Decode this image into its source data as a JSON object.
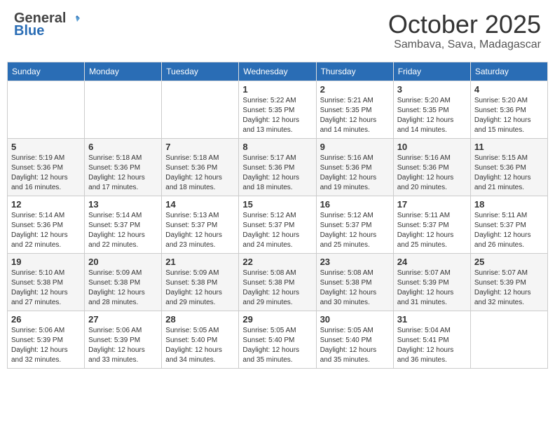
{
  "logo": {
    "general": "General",
    "blue": "Blue"
  },
  "header": {
    "month": "October 2025",
    "location": "Sambava, Sava, Madagascar"
  },
  "weekdays": [
    "Sunday",
    "Monday",
    "Tuesday",
    "Wednesday",
    "Thursday",
    "Friday",
    "Saturday"
  ],
  "weeks": [
    [
      {
        "day": "",
        "info": ""
      },
      {
        "day": "",
        "info": ""
      },
      {
        "day": "",
        "info": ""
      },
      {
        "day": "1",
        "info": "Sunrise: 5:22 AM\nSunset: 5:35 PM\nDaylight: 12 hours\nand 13 minutes."
      },
      {
        "day": "2",
        "info": "Sunrise: 5:21 AM\nSunset: 5:35 PM\nDaylight: 12 hours\nand 14 minutes."
      },
      {
        "day": "3",
        "info": "Sunrise: 5:20 AM\nSunset: 5:35 PM\nDaylight: 12 hours\nand 14 minutes."
      },
      {
        "day": "4",
        "info": "Sunrise: 5:20 AM\nSunset: 5:36 PM\nDaylight: 12 hours\nand 15 minutes."
      }
    ],
    [
      {
        "day": "5",
        "info": "Sunrise: 5:19 AM\nSunset: 5:36 PM\nDaylight: 12 hours\nand 16 minutes."
      },
      {
        "day": "6",
        "info": "Sunrise: 5:18 AM\nSunset: 5:36 PM\nDaylight: 12 hours\nand 17 minutes."
      },
      {
        "day": "7",
        "info": "Sunrise: 5:18 AM\nSunset: 5:36 PM\nDaylight: 12 hours\nand 18 minutes."
      },
      {
        "day": "8",
        "info": "Sunrise: 5:17 AM\nSunset: 5:36 PM\nDaylight: 12 hours\nand 18 minutes."
      },
      {
        "day": "9",
        "info": "Sunrise: 5:16 AM\nSunset: 5:36 PM\nDaylight: 12 hours\nand 19 minutes."
      },
      {
        "day": "10",
        "info": "Sunrise: 5:16 AM\nSunset: 5:36 PM\nDaylight: 12 hours\nand 20 minutes."
      },
      {
        "day": "11",
        "info": "Sunrise: 5:15 AM\nSunset: 5:36 PM\nDaylight: 12 hours\nand 21 minutes."
      }
    ],
    [
      {
        "day": "12",
        "info": "Sunrise: 5:14 AM\nSunset: 5:36 PM\nDaylight: 12 hours\nand 22 minutes."
      },
      {
        "day": "13",
        "info": "Sunrise: 5:14 AM\nSunset: 5:37 PM\nDaylight: 12 hours\nand 22 minutes."
      },
      {
        "day": "14",
        "info": "Sunrise: 5:13 AM\nSunset: 5:37 PM\nDaylight: 12 hours\nand 23 minutes."
      },
      {
        "day": "15",
        "info": "Sunrise: 5:12 AM\nSunset: 5:37 PM\nDaylight: 12 hours\nand 24 minutes."
      },
      {
        "day": "16",
        "info": "Sunrise: 5:12 AM\nSunset: 5:37 PM\nDaylight: 12 hours\nand 25 minutes."
      },
      {
        "day": "17",
        "info": "Sunrise: 5:11 AM\nSunset: 5:37 PM\nDaylight: 12 hours\nand 25 minutes."
      },
      {
        "day": "18",
        "info": "Sunrise: 5:11 AM\nSunset: 5:37 PM\nDaylight: 12 hours\nand 26 minutes."
      }
    ],
    [
      {
        "day": "19",
        "info": "Sunrise: 5:10 AM\nSunset: 5:38 PM\nDaylight: 12 hours\nand 27 minutes."
      },
      {
        "day": "20",
        "info": "Sunrise: 5:09 AM\nSunset: 5:38 PM\nDaylight: 12 hours\nand 28 minutes."
      },
      {
        "day": "21",
        "info": "Sunrise: 5:09 AM\nSunset: 5:38 PM\nDaylight: 12 hours\nand 29 minutes."
      },
      {
        "day": "22",
        "info": "Sunrise: 5:08 AM\nSunset: 5:38 PM\nDaylight: 12 hours\nand 29 minutes."
      },
      {
        "day": "23",
        "info": "Sunrise: 5:08 AM\nSunset: 5:38 PM\nDaylight: 12 hours\nand 30 minutes."
      },
      {
        "day": "24",
        "info": "Sunrise: 5:07 AM\nSunset: 5:39 PM\nDaylight: 12 hours\nand 31 minutes."
      },
      {
        "day": "25",
        "info": "Sunrise: 5:07 AM\nSunset: 5:39 PM\nDaylight: 12 hours\nand 32 minutes."
      }
    ],
    [
      {
        "day": "26",
        "info": "Sunrise: 5:06 AM\nSunset: 5:39 PM\nDaylight: 12 hours\nand 32 minutes."
      },
      {
        "day": "27",
        "info": "Sunrise: 5:06 AM\nSunset: 5:39 PM\nDaylight: 12 hours\nand 33 minutes."
      },
      {
        "day": "28",
        "info": "Sunrise: 5:05 AM\nSunset: 5:40 PM\nDaylight: 12 hours\nand 34 minutes."
      },
      {
        "day": "29",
        "info": "Sunrise: 5:05 AM\nSunset: 5:40 PM\nDaylight: 12 hours\nand 35 minutes."
      },
      {
        "day": "30",
        "info": "Sunrise: 5:05 AM\nSunset: 5:40 PM\nDaylight: 12 hours\nand 35 minutes."
      },
      {
        "day": "31",
        "info": "Sunrise: 5:04 AM\nSunset: 5:41 PM\nDaylight: 12 hours\nand 36 minutes."
      },
      {
        "day": "",
        "info": ""
      }
    ]
  ]
}
